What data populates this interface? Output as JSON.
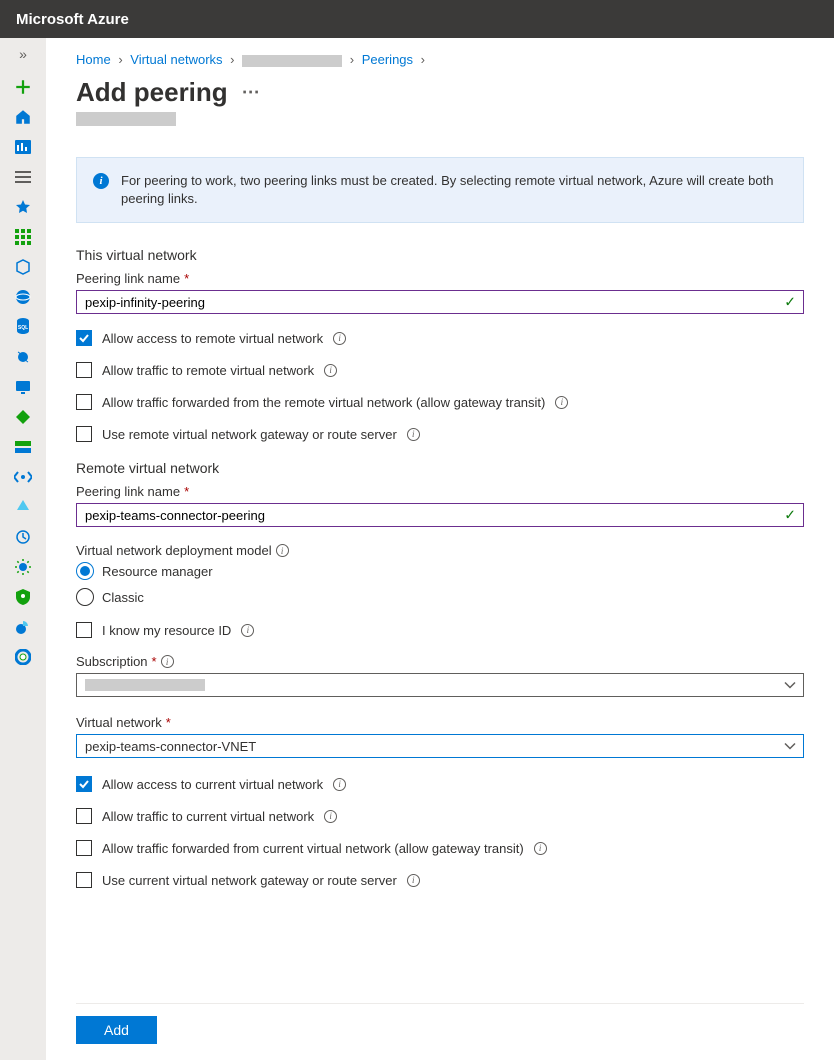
{
  "topbar": {
    "brand": "Microsoft Azure"
  },
  "breadcrumb": {
    "home": "Home",
    "vnets": "Virtual networks",
    "peerings": "Peerings"
  },
  "page": {
    "title": "Add peering"
  },
  "info": {
    "message": "For peering to work, two peering links must be created. By selecting remote virtual network, Azure will create both peering links."
  },
  "thisVnet": {
    "sectionTitle": "This virtual network",
    "peeringLinkLabel": "Peering link name",
    "peeringLinkValue": "pexip-infinity-peering",
    "allowAccess": "Allow access to remote virtual network",
    "allowTraffic": "Allow traffic to remote virtual network",
    "allowForwarded": "Allow traffic forwarded from the remote virtual network (allow gateway transit)",
    "useRemoteGateway": "Use remote virtual network gateway or route server"
  },
  "remoteVnet": {
    "sectionTitle": "Remote virtual network",
    "peeringLinkLabel": "Peering link name",
    "peeringLinkValue": "pexip-teams-connector-peering",
    "deployModelLabel": "Virtual network deployment model",
    "rm": "Resource manager",
    "classic": "Classic",
    "knowResourceId": "I know my resource ID",
    "subscriptionLabel": "Subscription",
    "vnetLabel": "Virtual network",
    "vnetValue": "pexip-teams-connector-VNET",
    "allowAccess": "Allow access to current virtual network",
    "allowTraffic": "Allow traffic to current virtual network",
    "allowForwarded": "Allow traffic forwarded from current virtual network (allow gateway transit)",
    "useGateway": "Use current virtual network gateway or route server"
  },
  "buttons": {
    "add": "Add"
  }
}
